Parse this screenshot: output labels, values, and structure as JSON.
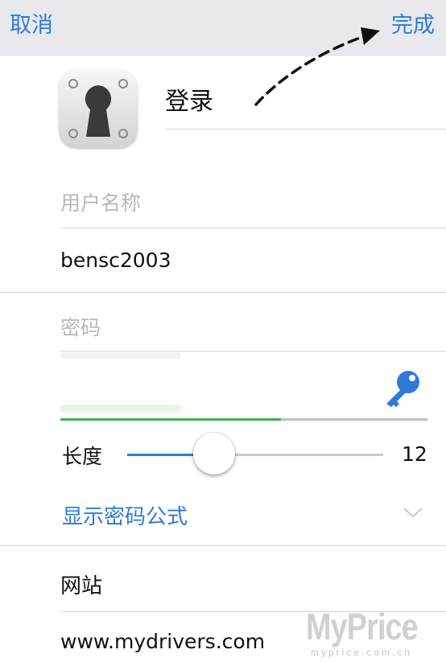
{
  "navbar": {
    "cancel_label": "取消",
    "done_label": "完成"
  },
  "item": {
    "title": "登录",
    "app_icon": "keyhole-icon"
  },
  "username": {
    "placeholder": "用户名称",
    "value": "bensc2003"
  },
  "password": {
    "placeholder": "密码",
    "value": "",
    "generator_icon": "key-icon",
    "strength_fraction": 0.6
  },
  "generator": {
    "length_label": "长度",
    "length_value": "12",
    "slider_fraction": 0.34,
    "show_formula_label": "显示密码公式",
    "expand_icon": "chevron-down-icon"
  },
  "website": {
    "label": "网站",
    "value": "www.mydrivers.com"
  },
  "watermark": {
    "brand": "MyPrice",
    "domain": "myprice.com.cn"
  },
  "colors": {
    "accent": "#2f7ad9",
    "strength": "#3cb34a",
    "navbar_bg": "#e9e9ed"
  }
}
